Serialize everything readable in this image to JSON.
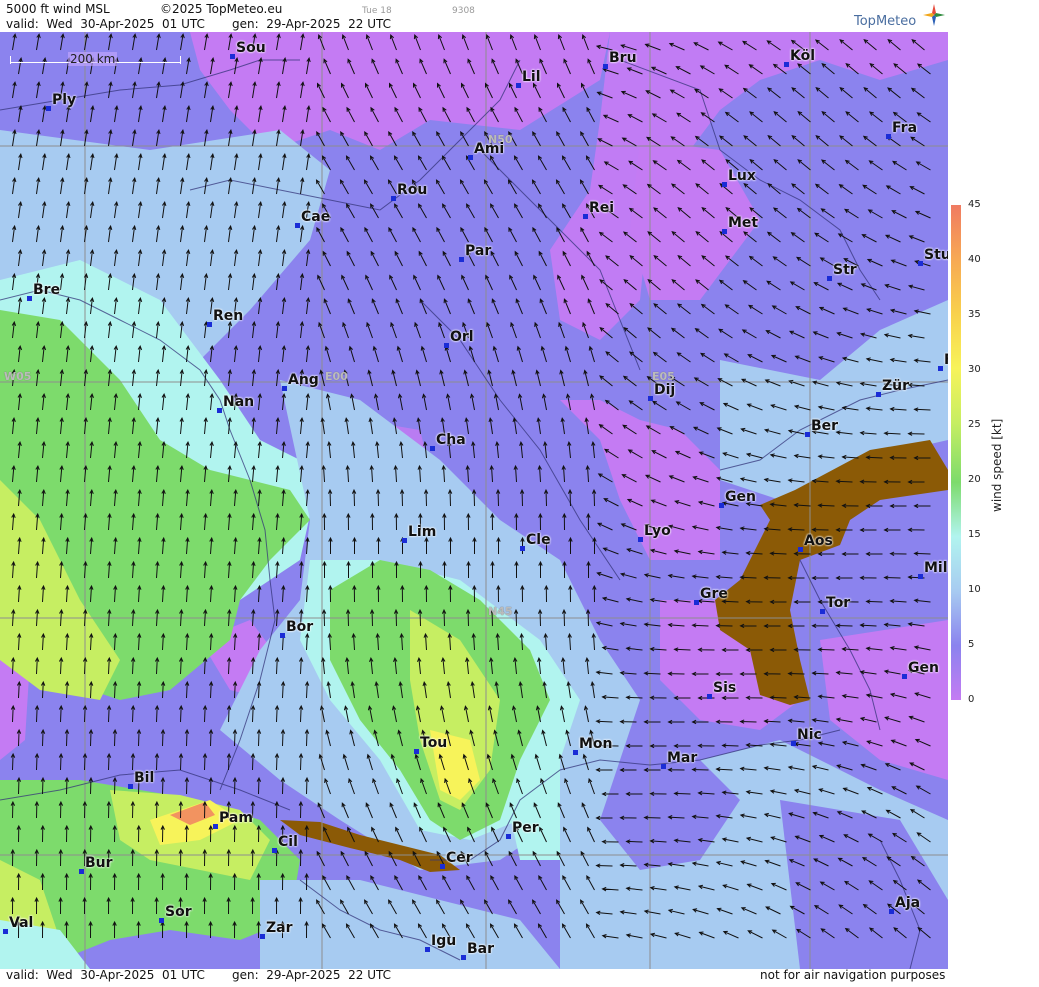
{
  "header": {
    "product": "5000 ft wind MSL",
    "copyright": "©2025 TopMeteo.eu",
    "faint_1": "Tue 18",
    "faint_2": "9308",
    "valid_label": "valid:  Wed  30-Apr-2025  01 UTC",
    "gen_label": "gen:  29-Apr-2025  22 UTC",
    "logo": "TopMeteo"
  },
  "footer": {
    "valid_label": "valid:  Wed  30-Apr-2025  01 UTC",
    "gen_label": "gen:  29-Apr-2025  22 UTC",
    "disclaimer": "not for air navigation purposes"
  },
  "scale_bar": "200 km",
  "grid_labels": [
    "N50",
    "N45",
    "W05",
    "E00",
    "E05"
  ],
  "legend": {
    "title": "wind  speed  [kt]",
    "ticks": [
      "45",
      "40",
      "35",
      "30",
      "25",
      "20",
      "15",
      "10",
      "5",
      "0"
    ],
    "colors": [
      "#f07b62",
      "#f7a954",
      "#f8d14c",
      "#f7f35a",
      "#c6ee62",
      "#7ddb6c",
      "#b1f4ef",
      "#a7cbf1",
      "#8b83ee",
      "#c47bf3"
    ]
  },
  "cities": [
    {
      "name": "Sou"
    },
    {
      "name": "Ply"
    },
    {
      "name": "Lil"
    },
    {
      "name": "Bru"
    },
    {
      "name": "Köl"
    },
    {
      "name": "Ami"
    },
    {
      "name": "Fra"
    },
    {
      "name": "Rou"
    },
    {
      "name": "Lux"
    },
    {
      "name": "Cae"
    },
    {
      "name": "Rei"
    },
    {
      "name": "Met"
    },
    {
      "name": "Par"
    },
    {
      "name": "Stu"
    },
    {
      "name": "Bre"
    },
    {
      "name": "Str"
    },
    {
      "name": "Ren"
    },
    {
      "name": "Orl"
    },
    {
      "name": "F"
    },
    {
      "name": "Ang"
    },
    {
      "name": "Dij"
    },
    {
      "name": "Zür"
    },
    {
      "name": "Nan"
    },
    {
      "name": "Ber"
    },
    {
      "name": "Cha"
    },
    {
      "name": "Gen"
    },
    {
      "name": "Lim"
    },
    {
      "name": "Cle"
    },
    {
      "name": "Lyo"
    },
    {
      "name": "Aos"
    },
    {
      "name": "Mil"
    },
    {
      "name": "Gre"
    },
    {
      "name": "Tor"
    },
    {
      "name": "Bor"
    },
    {
      "name": "Gen"
    },
    {
      "name": "Sis"
    },
    {
      "name": "Nic"
    },
    {
      "name": "Tou"
    },
    {
      "name": "Mon"
    },
    {
      "name": "Mar"
    },
    {
      "name": "Bil"
    },
    {
      "name": "Pam"
    },
    {
      "name": "Per"
    },
    {
      "name": "Cil"
    },
    {
      "name": "Cer"
    },
    {
      "name": "Bur"
    },
    {
      "name": "Sor"
    },
    {
      "name": "Aja"
    },
    {
      "name": "Val"
    },
    {
      "name": "Zar"
    },
    {
      "name": "Igu"
    },
    {
      "name": "Bar"
    }
  ]
}
